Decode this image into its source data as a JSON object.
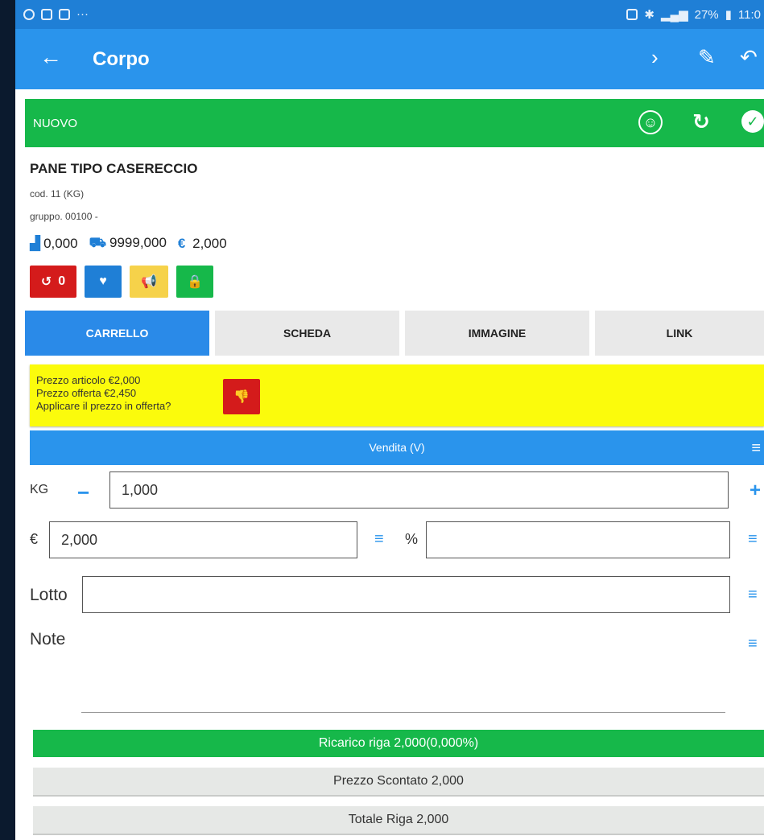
{
  "statusbar": {
    "battery": "27%",
    "time": "11:0"
  },
  "appbar": {
    "back_icon": "←",
    "title": "Corpo",
    "next_icon": "›",
    "edit_icon": "✎",
    "undo_icon": "↶"
  },
  "status_row": {
    "label": "NUOVO"
  },
  "product": {
    "name": "PANE TIPO CASERECCIO",
    "code": "cod. 11 (KG)",
    "group": "gruppo. 00100 -",
    "stock": "0,000",
    "incoming": "9999,000",
    "price": "2,000",
    "currency_symbol": "€"
  },
  "action_buttons": {
    "history_count": "0"
  },
  "tabs": [
    {
      "label": "CARRELLO"
    },
    {
      "label": "SCHEDA"
    },
    {
      "label": "IMMAGINE"
    },
    {
      "label": "LINK"
    }
  ],
  "offer": {
    "line1": "Prezzo articolo €2,000",
    "line2": "Prezzo offerta €2,450",
    "line3": "Applicare il prezzo in offerta?"
  },
  "sale": {
    "header": "Vendita (V)",
    "qty_label": "KG",
    "qty_value": "1,000",
    "price_label": "€",
    "price_value": "2,000",
    "discount_label": "%",
    "discount_value": "",
    "lot_label": "Lotto",
    "lot_value": "",
    "note_label": "Note"
  },
  "summary": {
    "markup": "Ricarico riga 2,000(0,000%)",
    "discounted_price": "Prezzo Scontato 2,000",
    "line_total": "Totale Riga 2,000"
  },
  "colors": {
    "appbar": "#2a94ec",
    "status_green": "#16b84a",
    "offer_yellow": "#fbfb0c",
    "red": "#d41b1b",
    "amber": "#f6d24a"
  }
}
